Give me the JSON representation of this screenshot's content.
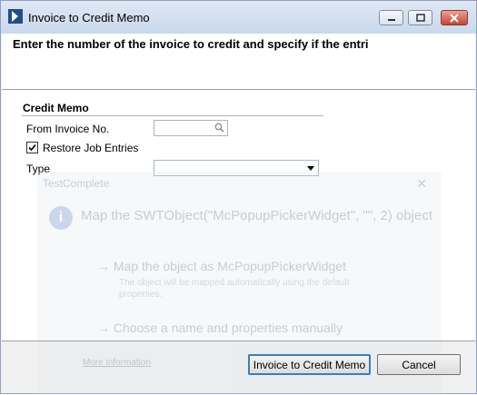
{
  "window": {
    "title": "Invoice to Credit Memo"
  },
  "header": {
    "instruction": "Enter the number of the invoice to credit and specify if the entri"
  },
  "form": {
    "section_title": "Credit Memo",
    "from_invoice_label": "From Invoice No.",
    "from_invoice_value": "",
    "restore_label": "Restore Job Entries",
    "restore_checked": true,
    "type_label": "Type",
    "type_value": ""
  },
  "overlay": {
    "title": "TestComplete",
    "heading": "Map the SWTObject(\"McPopupPickerWidget\", \"\", 2) object",
    "option1": "→ Map the object as McPopupPickerWidget",
    "option1_desc": "The object will be mapped automatically using the default properties.",
    "option2": "→ Choose a name and properties manually",
    "more_info": "More information"
  },
  "buttons": {
    "ok": "Invoice to Credit Memo",
    "cancel": "Cancel"
  },
  "icons": {
    "app": "app-logo-icon",
    "search": "search-icon",
    "minimize": "minimize-icon",
    "maximize": "maximize-icon",
    "close": "close-icon",
    "dropdown": "chevron-down-icon"
  }
}
